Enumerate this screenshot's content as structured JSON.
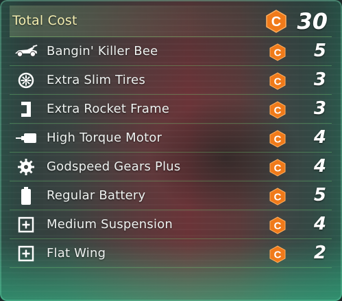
{
  "total": {
    "label": "Total Cost",
    "cost": "30",
    "currency_icon": "c-coin-icon"
  },
  "parts": [
    {
      "icon": "car-icon",
      "label": "Bangin' Killer Bee",
      "cost": "5"
    },
    {
      "icon": "tire-icon",
      "label": "Extra Slim Tires",
      "cost": "3"
    },
    {
      "icon": "frame-icon",
      "label": "Extra Rocket Frame",
      "cost": "3"
    },
    {
      "icon": "motor-icon",
      "label": "High Torque Motor",
      "cost": "4"
    },
    {
      "icon": "gear-icon",
      "label": "Godspeed Gears Plus",
      "cost": "4"
    },
    {
      "icon": "battery-icon",
      "label": "Regular Battery",
      "cost": "5"
    },
    {
      "icon": "plus-box-icon",
      "label": "Medium Suspension",
      "cost": "4"
    },
    {
      "icon": "plus-box-icon",
      "label": "Flat Wing",
      "cost": "2"
    }
  ],
  "colors": {
    "coin": "#f07a1a",
    "total_label": "#f3edb0",
    "divider": "#7adc78"
  }
}
